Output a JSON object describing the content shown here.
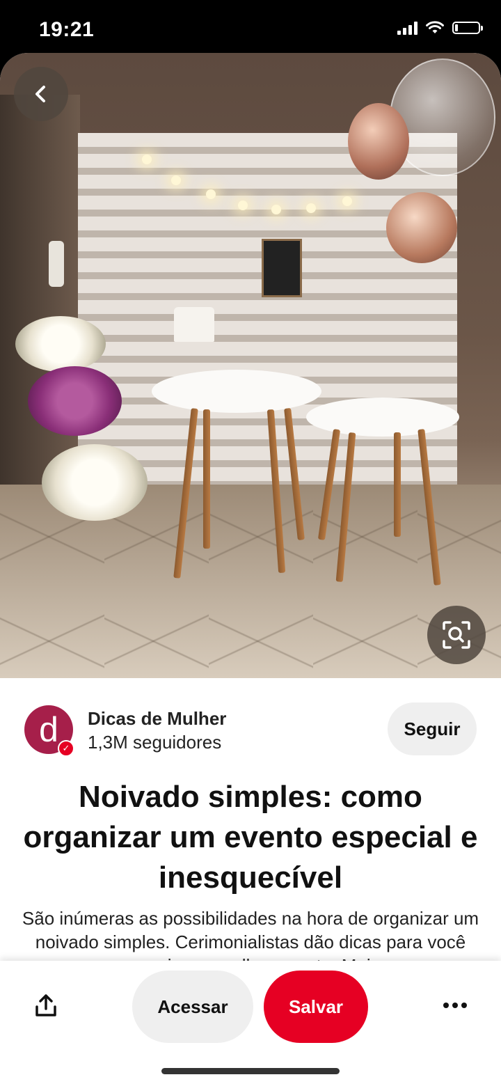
{
  "status_bar": {
    "time": "19:21"
  },
  "pin": {
    "image_alt": "Mesas de noivado decoradas com luzes, balões e flores",
    "creator": {
      "name": "Dicas de Mulher",
      "followers": "1,3M seguidores",
      "avatar_letter": "d",
      "avatar_color": "#a61f4a",
      "follow_label": "Seguir"
    },
    "title": "Noivado simples: como organizar um evento especial e inesquecível",
    "description": "São inúmeras as possibilidades na hora de organizar um noivado simples. Cerimonialistas dão dicas para você organizar o melhor evento. Mais"
  },
  "actions": {
    "visit_label": "Acessar",
    "save_label": "Salvar"
  },
  "colors": {
    "brand_red": "#e60023",
    "button_gray": "#efefef"
  },
  "icons": {
    "back": "chevron-left-icon",
    "visual_search": "lens-search-icon",
    "share": "share-icon",
    "more": "more-icon"
  }
}
